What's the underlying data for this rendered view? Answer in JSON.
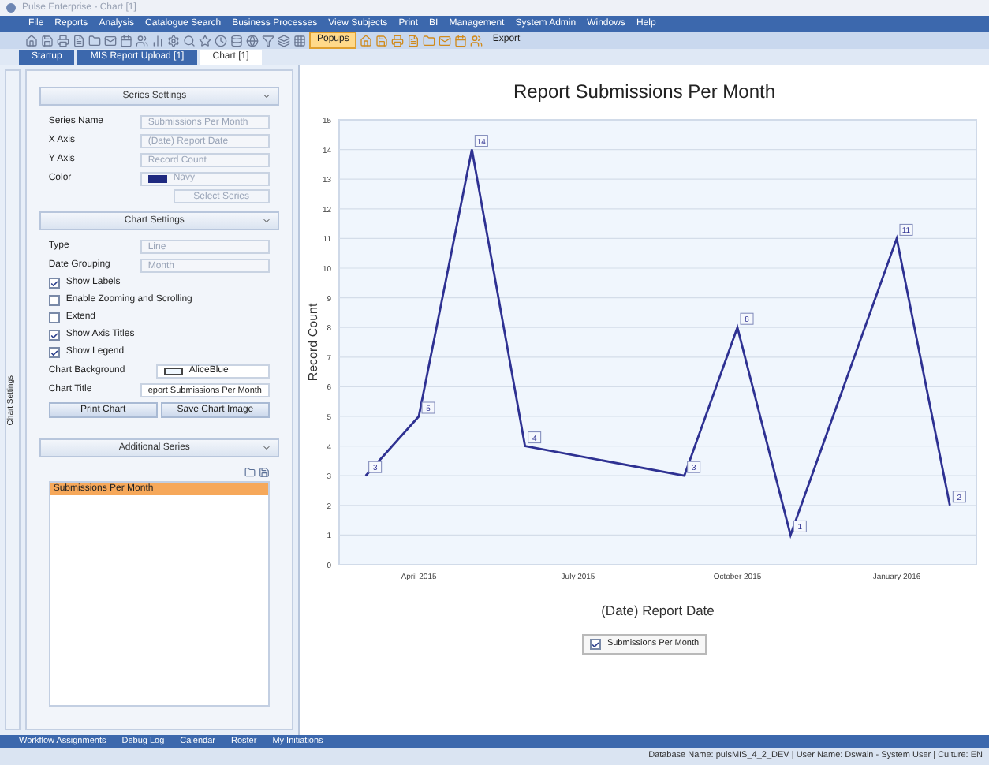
{
  "window": {
    "title": "Pulse Enterprise - Chart [1]"
  },
  "menu": [
    "File",
    "Reports",
    "Analysis",
    "Catalogue Search",
    "Business Processes",
    "View Subjects",
    "Print",
    "BI",
    "Management",
    "System Admin",
    "Windows",
    "Help"
  ],
  "toolbar": {
    "popups_label": "Popups",
    "popups_selected": true,
    "export_label": "Export"
  },
  "tabs": [
    {
      "label": "Startup",
      "selected": false
    },
    {
      "label": "MIS Report Upload [1]",
      "selected": false
    },
    {
      "label": "Chart [1]",
      "selected": true
    }
  ],
  "side_tab": "Chart Settings",
  "series_settings": {
    "title": "Series Settings",
    "fields": [
      {
        "label": "Series Name",
        "value": "Submissions Per Month"
      },
      {
        "label": "X Axis",
        "value": "(Date) Report Date"
      },
      {
        "label": "Y Axis",
        "value": "Record Count"
      }
    ],
    "color": {
      "label": "Color",
      "value": "Navy",
      "color": "#1f2a80"
    },
    "button": "Select Series"
  },
  "chart_settings": {
    "title": "Chart Settings",
    "fields": [
      {
        "label": "Type",
        "value": "Line"
      },
      {
        "label": "Date Grouping",
        "value": "Month"
      }
    ],
    "checkboxes": [
      {
        "label": "Show Labels",
        "checked": true
      },
      {
        "label": "Enable Zooming and Scrolling",
        "checked": false
      },
      {
        "label": "Extend",
        "checked": false
      },
      {
        "label": "Show Axis Titles",
        "checked": true
      },
      {
        "label": "Show Legend",
        "checked": true
      }
    ],
    "background": {
      "label": "Chart Background",
      "value": "AliceBlue",
      "color": "#f0f8ff"
    },
    "chart_title": {
      "label": "Chart Title",
      "value": "eport Submissions Per Month"
    },
    "buttons": [
      "Print Chart",
      "Save Chart Image"
    ]
  },
  "additional_series": {
    "title": "Additional Series",
    "items": [
      {
        "label": "Submissions Per Month",
        "selected": true
      }
    ]
  },
  "chart": {
    "legend": {
      "checked": true
    },
    "chart_data": {
      "type": "line",
      "title": "Report Submissions Per Month",
      "xlabel": "(Date) Report Date",
      "ylabel": "Record Count",
      "categories": [
        null,
        "April 2015",
        null,
        null,
        "July 2015",
        null,
        null,
        "October 2015",
        null,
        null,
        "January 2016",
        null
      ],
      "series": [
        {
          "name": "Submissions Per Month",
          "color": "#2e3192",
          "values": [
            3,
            5,
            14,
            4,
            null,
            null,
            3,
            8,
            1,
            null,
            11,
            2
          ]
        }
      ],
      "ylim": [
        0,
        15
      ],
      "yticks": [
        0,
        1,
        2,
        3,
        4,
        5,
        6,
        7,
        8,
        9,
        10,
        11,
        12,
        13,
        14,
        15
      ],
      "data_labels": true,
      "grid": true
    }
  },
  "bottom_tabs": [
    "Workflow Assignments",
    "Debug Log",
    "Calendar",
    "Roster",
    "My Initiations"
  ],
  "status_bar": "Database Name: pulsMIS_4_2_DEV | User Name: Dswain - System User | Culture: EN"
}
